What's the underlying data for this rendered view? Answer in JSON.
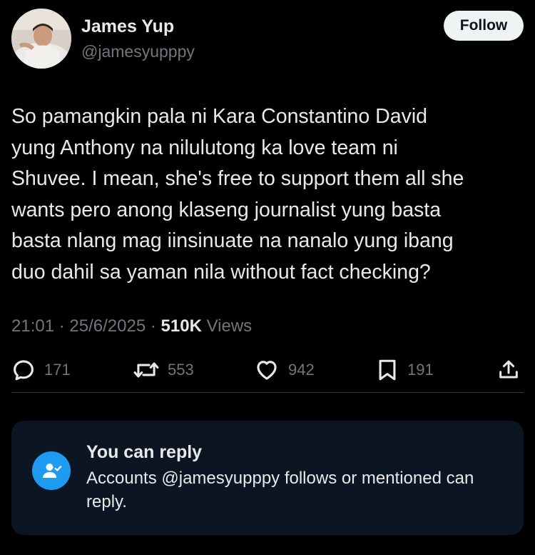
{
  "author": {
    "name": "James Yup",
    "handle": "@jamesyupppy",
    "avatar_icon": "profile-photo"
  },
  "follow_button": {
    "label": "Follow"
  },
  "tweet": {
    "text": "So pamangkin pala ni Kara Constantino David\nyung Anthony  na nilulutong ka love team ni\nShuvee. I mean, she's free to support them all she\nwants pero anong klaseng journalist yung basta\nbasta nlang mag iinsinuate na nanalo yung ibang\nduo dahil sa yaman nila without fact checking?",
    "time": "21:01",
    "separator": "·",
    "date": "25/6/2025",
    "views_count": "510K",
    "views_label": "Views"
  },
  "actions": {
    "replies": "171",
    "reposts": "553",
    "likes": "942",
    "bookmarks": "191"
  },
  "reply_restriction": {
    "title": "You can reply",
    "description": "Accounts @jamesyupppy follows or mentioned can reply."
  },
  "colors": {
    "background": "#000000",
    "text_primary": "#e7e9ea",
    "text_secondary": "#71767b",
    "accent": "#1d9bf0",
    "card_background": "#0c1622"
  }
}
